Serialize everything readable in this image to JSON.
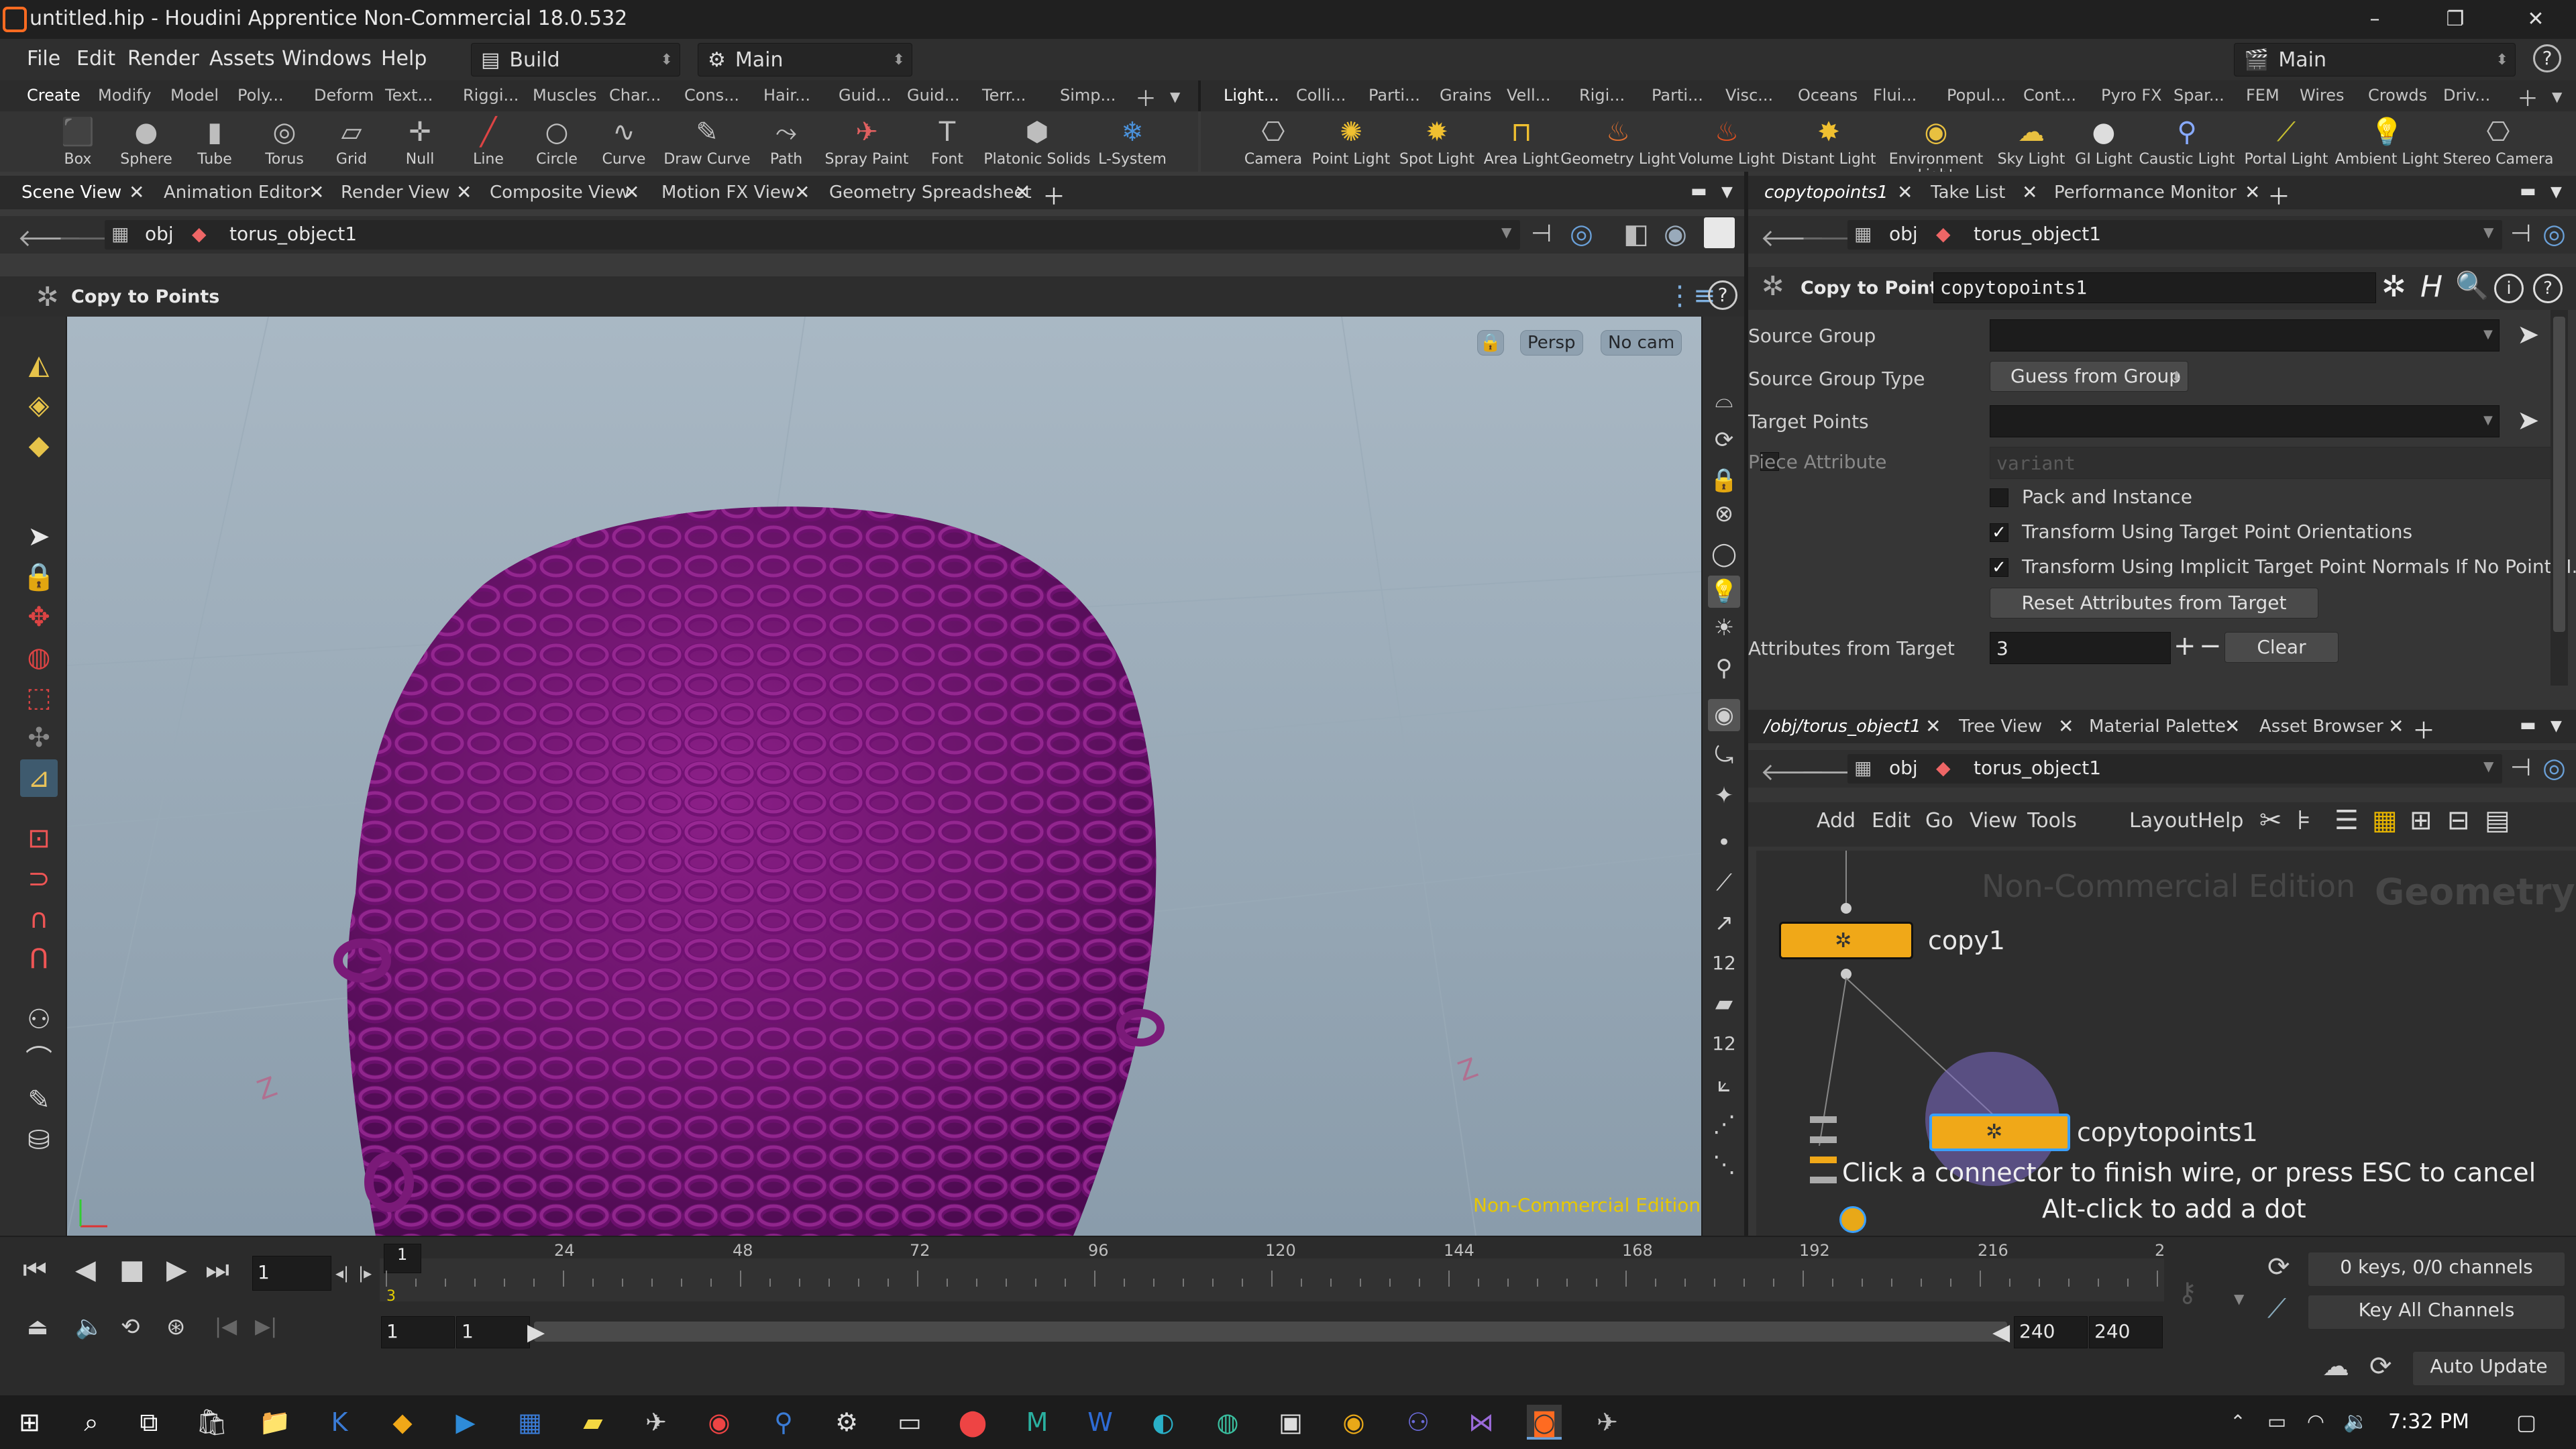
{
  "window": {
    "title": "untitled.hip - Houdini Apprentice Non-Commercial 18.0.532",
    "minimize": "–",
    "restore": "❐",
    "close": "✕"
  },
  "menubar": {
    "items": [
      "File",
      "Edit",
      "Render",
      "Assets",
      "Windows",
      "Help"
    ],
    "desktop": "Build",
    "tool": "Main",
    "right_desktop": "Main",
    "help": "?"
  },
  "shelf_tabs_left": [
    "Create",
    "Modify",
    "Model",
    "Poly...",
    "Deform",
    "Text...",
    "Riggi...",
    "Muscles",
    "Char...",
    "Cons...",
    "Hair...",
    "Guid...",
    "Guid...",
    "Terr...",
    "Simp..."
  ],
  "shelf_tabs_right": [
    "Light...",
    "Colli...",
    "Parti...",
    "Grains",
    "Vell...",
    "Rigi...",
    "Parti...",
    "Visc...",
    "Oceans",
    "Flui...",
    "Popul...",
    "Cont...",
    "Pyro FX",
    "Spar...",
    "FEM",
    "Wires",
    "Crowds",
    "Driv..."
  ],
  "shelf_tools_left": [
    {
      "label": "Box",
      "icon": "box-icon"
    },
    {
      "label": "Sphere",
      "icon": "sphere-icon"
    },
    {
      "label": "Tube",
      "icon": "tube-icon"
    },
    {
      "label": "Torus",
      "icon": "torus-icon"
    },
    {
      "label": "Grid",
      "icon": "grid-icon"
    },
    {
      "label": "Null",
      "icon": "null-icon"
    },
    {
      "label": "Line",
      "icon": "line-icon"
    },
    {
      "label": "Circle",
      "icon": "circle-icon"
    },
    {
      "label": "Curve",
      "icon": "curve-icon"
    },
    {
      "label": "Draw Curve",
      "icon": "draw-curve-icon"
    },
    {
      "label": "Path",
      "icon": "path-icon"
    },
    {
      "label": "Spray Paint",
      "icon": "spray-paint-icon"
    },
    {
      "label": "Font",
      "icon": "font-icon"
    },
    {
      "label": "Platonic Solids",
      "icon": "platonic-icon"
    },
    {
      "label": "L-System",
      "icon": "lsystem-icon"
    }
  ],
  "shelf_tools_right": [
    {
      "label": "Camera",
      "icon": "camera-icon"
    },
    {
      "label": "Point Light",
      "icon": "point-light-icon"
    },
    {
      "label": "Spot Light",
      "icon": "spot-light-icon"
    },
    {
      "label": "Area Light",
      "icon": "area-light-icon"
    },
    {
      "label": "Geometry Light",
      "icon": "geometry-light-icon"
    },
    {
      "label": "Volume Light",
      "icon": "volume-light-icon"
    },
    {
      "label": "Distant Light",
      "icon": "distant-light-icon"
    },
    {
      "label": "Environment Light",
      "icon": "environment-light-icon"
    },
    {
      "label": "Sky Light",
      "icon": "sky-light-icon"
    },
    {
      "label": "GI Light",
      "icon": "gi-light-icon"
    },
    {
      "label": "Caustic Light",
      "icon": "caustic-light-icon"
    },
    {
      "label": "Portal Light",
      "icon": "portal-light-icon"
    },
    {
      "label": "Ambient Light",
      "icon": "ambient-light-icon"
    },
    {
      "label": "Stereo Camera",
      "icon": "stereo-camera-icon"
    }
  ],
  "left_pane": {
    "tabs": [
      "Scene View",
      "Animation Editor",
      "Render View",
      "Composite View",
      "Motion FX View",
      "Geometry Spreadsheet"
    ],
    "path": {
      "root": "obj",
      "node": "torus_object1"
    },
    "operation": "Copy to Points"
  },
  "viewport": {
    "persp": "Persp",
    "cam": "No cam",
    "watermark": "Non-Commercial Edition",
    "geometry_color": "#7a1a78"
  },
  "right_pane": {
    "tabs": [
      "copytopoints1",
      "Take List",
      "Performance Monitor"
    ],
    "path": {
      "root": "obj",
      "node": "torus_object1"
    },
    "node_type": "Copy to Points",
    "node_name": "copytopoints1",
    "params": {
      "source_group_label": "Source Group",
      "source_group_type_label": "Source Group Type",
      "source_group_type_value": "Guess from Group",
      "target_points_label": "Target Points",
      "piece_attribute_label": "Piece Attribute",
      "piece_attribute_placeholder": "variant",
      "pack_label": "Pack and Instance",
      "transform_orient_label": "Transform Using Target Point Orientations",
      "transform_normals_label": "Transform Using Implicit Target Point Normals If No Point N...",
      "reset_label": "Reset Attributes from Target",
      "attrs_label": "Attributes from Target",
      "attrs_value": "3",
      "clear_label": "Clear"
    }
  },
  "network_pane": {
    "tabs": [
      "/obj/torus_object1",
      "Tree View",
      "Material Palette",
      "Asset Browser"
    ],
    "path": {
      "root": "obj",
      "node": "torus_object1"
    },
    "menu": [
      "Add",
      "Edit",
      "Go",
      "View",
      "Tools",
      "Layout",
      "Help"
    ],
    "watermark": "Non-Commercial Edition",
    "context": "Geometry",
    "node1": "copy1",
    "node2": "copytopoints1",
    "hint1": "Click a connector to finish wire, or press ESC to cancel",
    "hint2": "Alt-click to add a dot"
  },
  "timeline": {
    "frame": "1",
    "ticks": [
      "24",
      "48",
      "72",
      "96",
      "120",
      "144",
      "168",
      "192",
      "216",
      "2"
    ],
    "range_start": "1",
    "range_start2": "1",
    "range_end": "240",
    "range_end2": "240",
    "keys": "0 keys, 0/0 channels",
    "key_all": "Key All Channels",
    "auto_update": "Auto Update",
    "marker": "3",
    "current": "1"
  },
  "taskbar": {
    "time": "7:32 PM"
  }
}
